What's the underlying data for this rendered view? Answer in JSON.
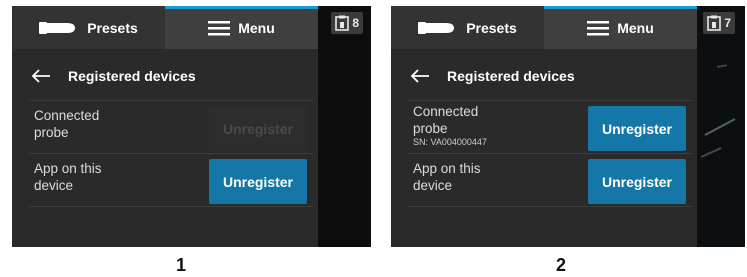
{
  "panels": [
    {
      "tabs": {
        "presets": "Presets",
        "menu": "Menu"
      },
      "badge_count": "8",
      "header_title": "Registered devices",
      "rows": [
        {
          "label_line1": "Connected",
          "label_line2": "probe",
          "sn": "",
          "button": "Unregister",
          "button_enabled": false
        },
        {
          "label_line1": "App on this",
          "label_line2": "device",
          "sn": "",
          "button": "Unregister",
          "button_enabled": true
        }
      ],
      "caption": "1"
    },
    {
      "tabs": {
        "presets": "Presets",
        "menu": "Menu"
      },
      "badge_count": "7",
      "header_title": "Registered devices",
      "rows": [
        {
          "label_line1": "Connected",
          "label_line2": "probe",
          "sn": "SN: VA004000447",
          "button": "Unregister",
          "button_enabled": true
        },
        {
          "label_line1": "App on this",
          "label_line2": "device",
          "sn": "",
          "button": "Unregister",
          "button_enabled": true
        }
      ],
      "caption": "2"
    }
  ],
  "colors": {
    "accent_blue": "#1a9bd0",
    "button_blue": "#1477a8",
    "screen_bg": "#2a2a2a",
    "tab_bg": "#3a3a3a"
  },
  "icons": {
    "presets": "probe-icon",
    "menu": "hamburger-menu-icon",
    "back": "back-arrow-icon",
    "badge": "clipboard-icon"
  }
}
